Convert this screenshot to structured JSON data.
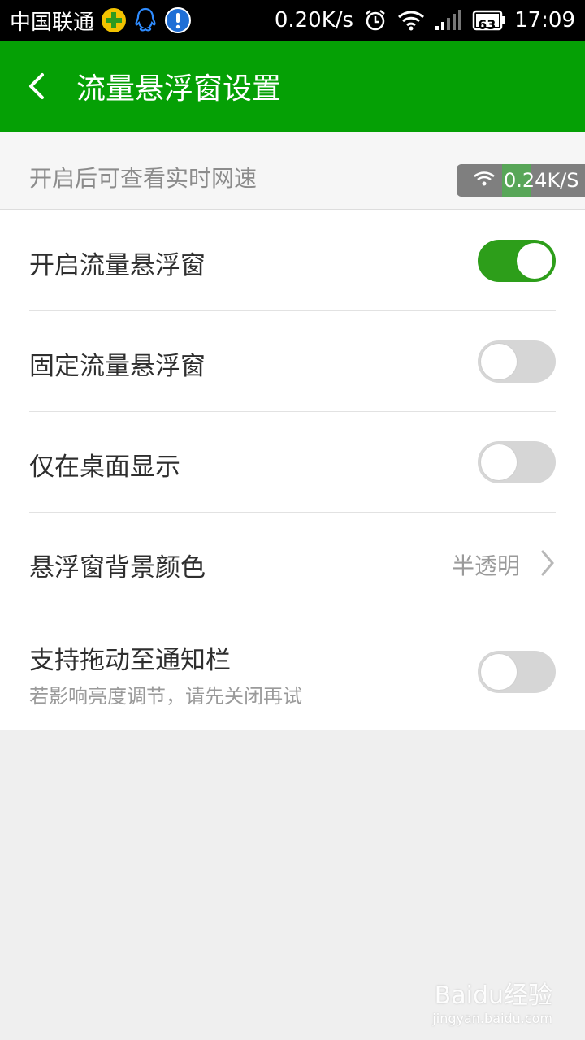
{
  "statusbar": {
    "carrier": "中国联通",
    "net_speed": "0.20K/s",
    "battery": "63",
    "time": "17:09"
  },
  "header": {
    "title": "流量悬浮窗设置"
  },
  "info": {
    "text": "开启后可查看实时网速",
    "speed_preview": "0.24K/S"
  },
  "settings": [
    {
      "label": "开启流量悬浮窗",
      "toggle": true
    },
    {
      "label": "固定流量悬浮窗",
      "toggle": false
    },
    {
      "label": "仅在桌面显示",
      "toggle": false
    },
    {
      "label": "悬浮窗背景颜色",
      "value": "半透明"
    },
    {
      "label": "支持拖动至通知栏",
      "sub": "若影响亮度调节，请先关闭再试",
      "toggle": false
    }
  ],
  "watermark": {
    "brand": "Baidu经验",
    "url": "jingyan.baidu.com"
  },
  "colors": {
    "accent": "#05a005",
    "toggle_on": "#2d9e1a",
    "toggle_off": "#d6d6d6"
  }
}
